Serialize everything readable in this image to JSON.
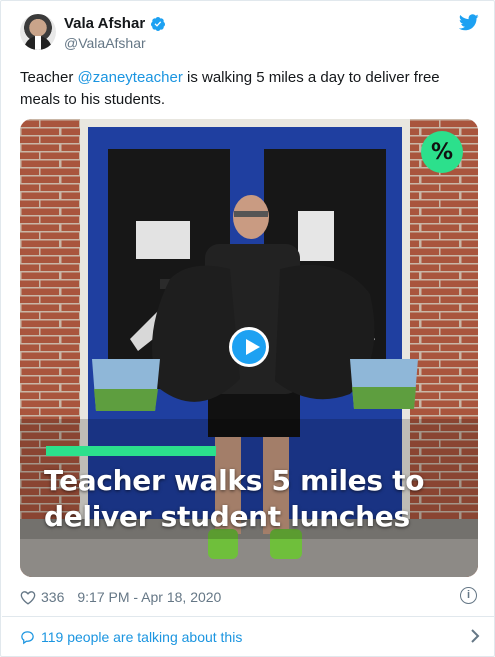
{
  "user": {
    "name": "Vala Afshar",
    "handle": "@ValaAfshar",
    "avatar_icon": "avatar",
    "verified_icon": "verified-badge-icon"
  },
  "tweet": {
    "text_before": "Teacher ",
    "mention": "@zaneyteacher",
    "text_after": " is walking 5 miles a day to deliver free meals to his students."
  },
  "media": {
    "badge_text": "%",
    "caption_line1": "Teacher walks 5 miles to",
    "caption_line2": "deliver student lunches",
    "play_icon": "play-icon",
    "accent_color": "#2ce08c"
  },
  "meta": {
    "likes": "336",
    "timestamp": "9:17 PM - Apr 18, 2020",
    "info": "i"
  },
  "footer": {
    "talking": "119 people are talking about this"
  },
  "colors": {
    "link": "#1b95e0",
    "secondary": "#657786",
    "twitter_blue": "#1da1f2"
  }
}
